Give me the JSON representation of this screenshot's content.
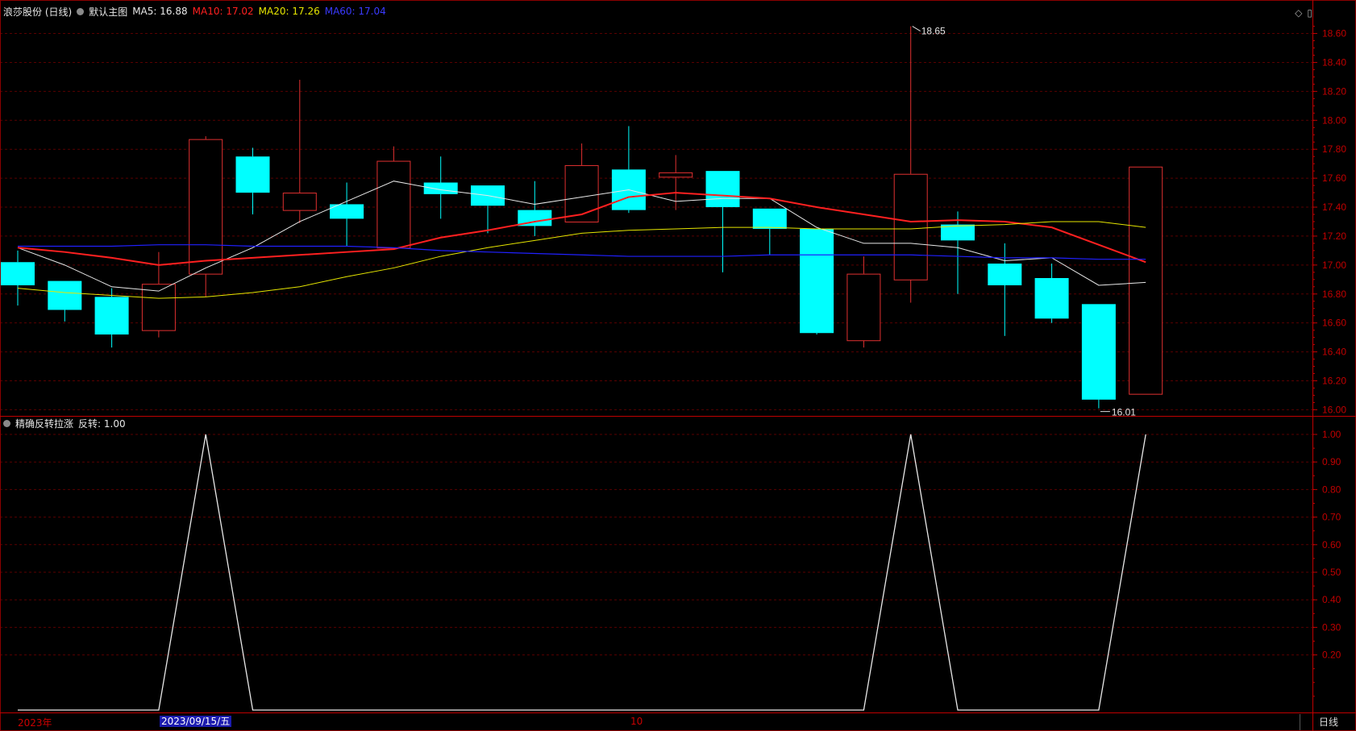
{
  "header": {
    "stock_label": "浪莎股份 (日线)",
    "main_chart_label": "默认主图",
    "ma5": "MA5: 16.88",
    "ma10": "MA10: 17.02",
    "ma20": "MA20: 17.26",
    "ma60": "MA60: 17.04",
    "icons": [
      "diamond-icon",
      "panel-toggle-icon"
    ]
  },
  "indicator_header": {
    "name": "精确反转拉涨",
    "value": "反转: 1.00"
  },
  "colors": {
    "up": "#e03030",
    "down": "#00ffff",
    "ma5": "#e8e8e8",
    "ma10": "#ff2020",
    "ma20": "#e6e600",
    "ma60": "#2020ff",
    "indicator": "#e8e8e8",
    "axis": "#c00000"
  },
  "bottom_axis": {
    "year_label": "2023年",
    "cursor_date": "2023/09/15/五",
    "month_label": "10",
    "period_label": "日线"
  },
  "chart_data": {
    "type": "candlestick",
    "price_axis": {
      "range": [
        15.98,
        18.72
      ],
      "ticks": [
        "18.60",
        "18.40",
        "18.20",
        "18.00",
        "17.80",
        "17.60",
        "17.40",
        "17.20",
        "17.00",
        "16.80",
        "16.60",
        "16.40",
        "16.20",
        "16.00"
      ]
    },
    "annotations": {
      "high": "18.65",
      "low": "16.01"
    },
    "candles": [
      {
        "o": 17.02,
        "h": 17.1,
        "l": 16.72,
        "c": 16.86
      },
      {
        "o": 16.89,
        "h": 16.89,
        "l": 16.61,
        "c": 16.69
      },
      {
        "o": 16.78,
        "h": 16.84,
        "l": 16.43,
        "c": 16.52
      },
      {
        "o": 16.55,
        "h": 17.09,
        "l": 16.5,
        "c": 16.87
      },
      {
        "o": 16.94,
        "h": 17.89,
        "l": 16.78,
        "c": 17.87
      },
      {
        "o": 17.75,
        "h": 17.81,
        "l": 17.35,
        "c": 17.5
      },
      {
        "o": 17.38,
        "h": 18.28,
        "l": 17.29,
        "c": 17.5
      },
      {
        "o": 17.42,
        "h": 17.57,
        "l": 17.13,
        "c": 17.32
      },
      {
        "o": 17.12,
        "h": 17.82,
        "l": 17.12,
        "c": 17.72
      },
      {
        "o": 17.57,
        "h": 17.75,
        "l": 17.32,
        "c": 17.49
      },
      {
        "o": 17.55,
        "h": 17.55,
        "l": 17.22,
        "c": 17.41
      },
      {
        "o": 17.38,
        "h": 17.58,
        "l": 17.2,
        "c": 17.27
      },
      {
        "o": 17.3,
        "h": 17.84,
        "l": 17.3,
        "c": 17.69
      },
      {
        "o": 17.66,
        "h": 17.96,
        "l": 17.36,
        "c": 17.38
      },
      {
        "o": 17.61,
        "h": 17.76,
        "l": 17.38,
        "c": 17.64
      },
      {
        "o": 17.65,
        "h": 17.65,
        "l": 16.95,
        "c": 17.4
      },
      {
        "o": 17.39,
        "h": 17.39,
        "l": 17.07,
        "c": 17.25
      },
      {
        "o": 17.25,
        "h": 17.25,
        "l": 16.52,
        "c": 16.53
      },
      {
        "o": 16.48,
        "h": 17.06,
        "l": 16.43,
        "c": 16.94
      },
      {
        "o": 16.9,
        "h": 18.65,
        "l": 16.74,
        "c": 17.63
      },
      {
        "o": 17.28,
        "h": 17.37,
        "l": 16.8,
        "c": 17.17
      },
      {
        "o": 17.01,
        "h": 17.15,
        "l": 16.51,
        "c": 16.86
      },
      {
        "o": 16.91,
        "h": 17.01,
        "l": 16.6,
        "c": 16.63
      },
      {
        "o": 16.73,
        "h": 16.73,
        "l": 16.01,
        "c": 16.07
      },
      {
        "o": 16.11,
        "h": 17.68,
        "l": 16.11,
        "c": 17.68
      }
    ],
    "ma_lines": [
      {
        "name": "MA5",
        "values": [
          17.12,
          17.0,
          16.85,
          16.82,
          16.98,
          17.12,
          17.3,
          17.44,
          17.58,
          17.52,
          17.48,
          17.42,
          17.47,
          17.52,
          17.44,
          17.46,
          17.46,
          17.26,
          17.15,
          17.15,
          17.12,
          17.03,
          17.05,
          16.86,
          16.88
        ]
      },
      {
        "name": "MA10",
        "values": [
          17.12,
          17.09,
          17.05,
          17.0,
          17.03,
          17.05,
          17.07,
          17.09,
          17.11,
          17.19,
          17.24,
          17.3,
          17.35,
          17.47,
          17.5,
          17.48,
          17.46,
          17.4,
          17.35,
          17.3,
          17.31,
          17.3,
          17.26,
          17.14,
          17.02
        ]
      },
      {
        "name": "MA20",
        "values": [
          16.84,
          16.81,
          16.79,
          16.77,
          16.78,
          16.81,
          16.85,
          16.92,
          16.98,
          17.06,
          17.12,
          17.17,
          17.22,
          17.24,
          17.25,
          17.26,
          17.26,
          17.25,
          17.25,
          17.25,
          17.27,
          17.28,
          17.3,
          17.3,
          17.26
        ]
      },
      {
        "name": "MA60",
        "values": [
          17.13,
          17.13,
          17.13,
          17.14,
          17.14,
          17.13,
          17.13,
          17.13,
          17.12,
          17.1,
          17.09,
          17.08,
          17.07,
          17.06,
          17.06,
          17.06,
          17.07,
          17.07,
          17.07,
          17.07,
          17.06,
          17.05,
          17.05,
          17.04,
          17.04
        ]
      }
    ],
    "indicator": {
      "name": "反转",
      "range": [
        0,
        1.0
      ],
      "ticks": [
        "1.00",
        "0.90",
        "0.80",
        "0.70",
        "0.60",
        "0.50",
        "0.40",
        "0.30",
        "0.20"
      ],
      "values": [
        0,
        0,
        0,
        0,
        1,
        0,
        0,
        0,
        0,
        0,
        0,
        0,
        0,
        0,
        0,
        0,
        0,
        0,
        0,
        1,
        0,
        0,
        0,
        0,
        1
      ]
    }
  }
}
